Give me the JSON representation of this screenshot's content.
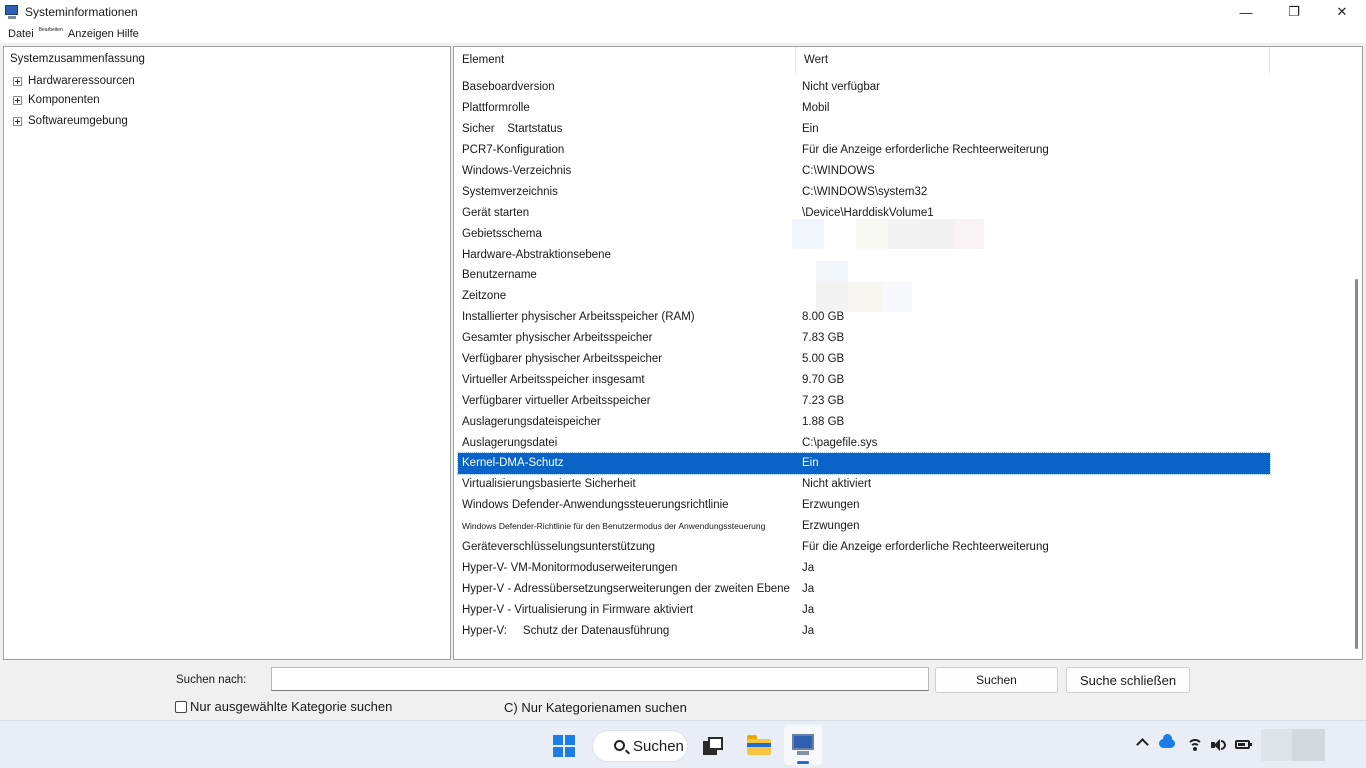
{
  "window": {
    "title": "Systeminformationen",
    "controls": {
      "minimize": "—",
      "maximize": "❐",
      "close": "✕"
    }
  },
  "menu": [
    "Datei",
    "Bearbeiten",
    "Anzeigen",
    "Hilfe"
  ],
  "tree": {
    "root": "Systemzusammenfassung",
    "children": [
      "Hardwareressourcen",
      "Komponenten",
      "Softwareumgebung"
    ]
  },
  "table": {
    "columns": [
      "Element",
      "Wert"
    ],
    "rows": [
      {
        "item": "Baseboardversion",
        "value": "Nicht verfügbar"
      },
      {
        "item": "Plattformrolle",
        "value": "Mobil"
      },
      {
        "item": "Sicher    Startstatus",
        "value": "Ein"
      },
      {
        "item": "PCR7-Konfiguration",
        "value": "Für die Anzeige erforderliche Rechteerweiterung"
      },
      {
        "item": "Windows-Verzeichnis",
        "value": "C:\\WINDOWS"
      },
      {
        "item": "Systemverzeichnis",
        "value": "C:\\WINDOWS\\system32"
      },
      {
        "item": "Gerät starten",
        "value": "\\Device\\HarddiskVolume1"
      },
      {
        "item": "Gebietsschema",
        "value": ""
      },
      {
        "item": "Hardware-Abstraktionsebene",
        "value": ""
      },
      {
        "item": "Benutzername",
        "value": ""
      },
      {
        "item": "Zeitzone",
        "value": ""
      },
      {
        "item": "Installierter physischer Arbeitsspeicher (RAM)",
        "value": "8.00 GB"
      },
      {
        "item": "Gesamter physischer Arbeitsspeicher",
        "value": "7.83 GB"
      },
      {
        "item": "Verfügbarer physischer Arbeitsspeicher",
        "value": "5.00 GB"
      },
      {
        "item": "Virtueller Arbeitsspeicher insgesamt",
        "value": "9.70 GB"
      },
      {
        "item": "Verfügbarer virtueller Arbeitsspeicher",
        "value": "7.23 GB"
      },
      {
        "item": "Auslagerungsdateispeicher",
        "value": "1.88 GB"
      },
      {
        "item": "Auslagerungsdatei",
        "value": "C:\\pagefile.sys"
      },
      {
        "item": "Kernel-DMA-Schutz",
        "value": "Ein"
      },
      {
        "item": "Virtualisierungsbasierte Sicherheit",
        "value": "Nicht aktiviert"
      },
      {
        "item": "Windows Defender-Anwendungssteuerungsrichtlinie",
        "value": "Erzwungen"
      },
      {
        "item": "Windows Defender-Richtlinie für den Benutzermodus der Anwendungssteuerung",
        "value": "Erzwungen"
      },
      {
        "item": "Geräteverschlüsselungsunterstützung",
        "value": "Für die Anzeige erforderliche Rechteerweiterung"
      },
      {
        "item": "Hyper-V- VM-Monitormoduserweiterungen",
        "value": "Ja"
      },
      {
        "item": "Hyper-V - Adressübersetzungserweiterungen der zweiten Ebene",
        "value": "Ja"
      },
      {
        "item": "Hyper-V - Virtualisierung in Firmware aktiviert",
        "value": "Ja"
      },
      {
        "item": "Hyper-V:     Schutz der Datenausführung",
        "value": "Ja"
      }
    ]
  },
  "search": {
    "label": "Suchen nach:",
    "value": "",
    "search_button": "Suchen",
    "close_button": "Suche schließen",
    "checkbox_label": "Nur ausgewählte Kategorie suchen",
    "radio_label": "C) Nur Kategorienamen suchen"
  },
  "taskbar": {
    "search_label": "Suchen",
    "icons": [
      "windows-start-icon",
      "search-icon",
      "task-view-icon",
      "file-explorer-icon",
      "system-information-icon"
    ],
    "tray_icons": [
      "chevron-up-icon",
      "onedrive-cloud-icon",
      "wifi-icon",
      "speaker-icon",
      "battery-icon"
    ]
  },
  "colors": {
    "selection": "#0a64c8",
    "accent": "#1a7ee6"
  }
}
